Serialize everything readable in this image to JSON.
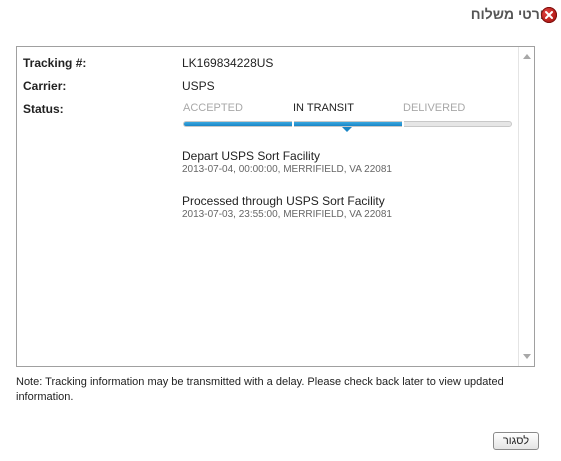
{
  "dialog": {
    "title": "פרטי משלוח",
    "close_icon": "close-icon",
    "close_icon_color": "#c0201c"
  },
  "tracking": {
    "fields": [
      {
        "label": "Tracking #:",
        "value": "LK169834228US"
      },
      {
        "label": "Carrier:",
        "value": "USPS"
      },
      {
        "label": "Status:",
        "value": ""
      }
    ],
    "status_stages": [
      "ACCEPTED",
      "IN TRANSIT",
      "DELIVERED"
    ],
    "current_stage": "IN TRANSIT",
    "progress_fraction": 0.67,
    "progress_color": "#1a86c6"
  },
  "events": [
    {
      "title": "Depart USPS Sort Facility",
      "meta": "2013-07-04, 00:00:00, MERRIFIELD, VA 22081"
    },
    {
      "title": "Processed through USPS Sort Facility",
      "meta": "2013-07-03, 23:55:00, MERRIFIELD, VA 22081"
    }
  ],
  "note": "Note: Tracking information may be transmitted with a delay. Please check back later to view updated information.",
  "footer": {
    "close_button_label": "לסגור"
  }
}
